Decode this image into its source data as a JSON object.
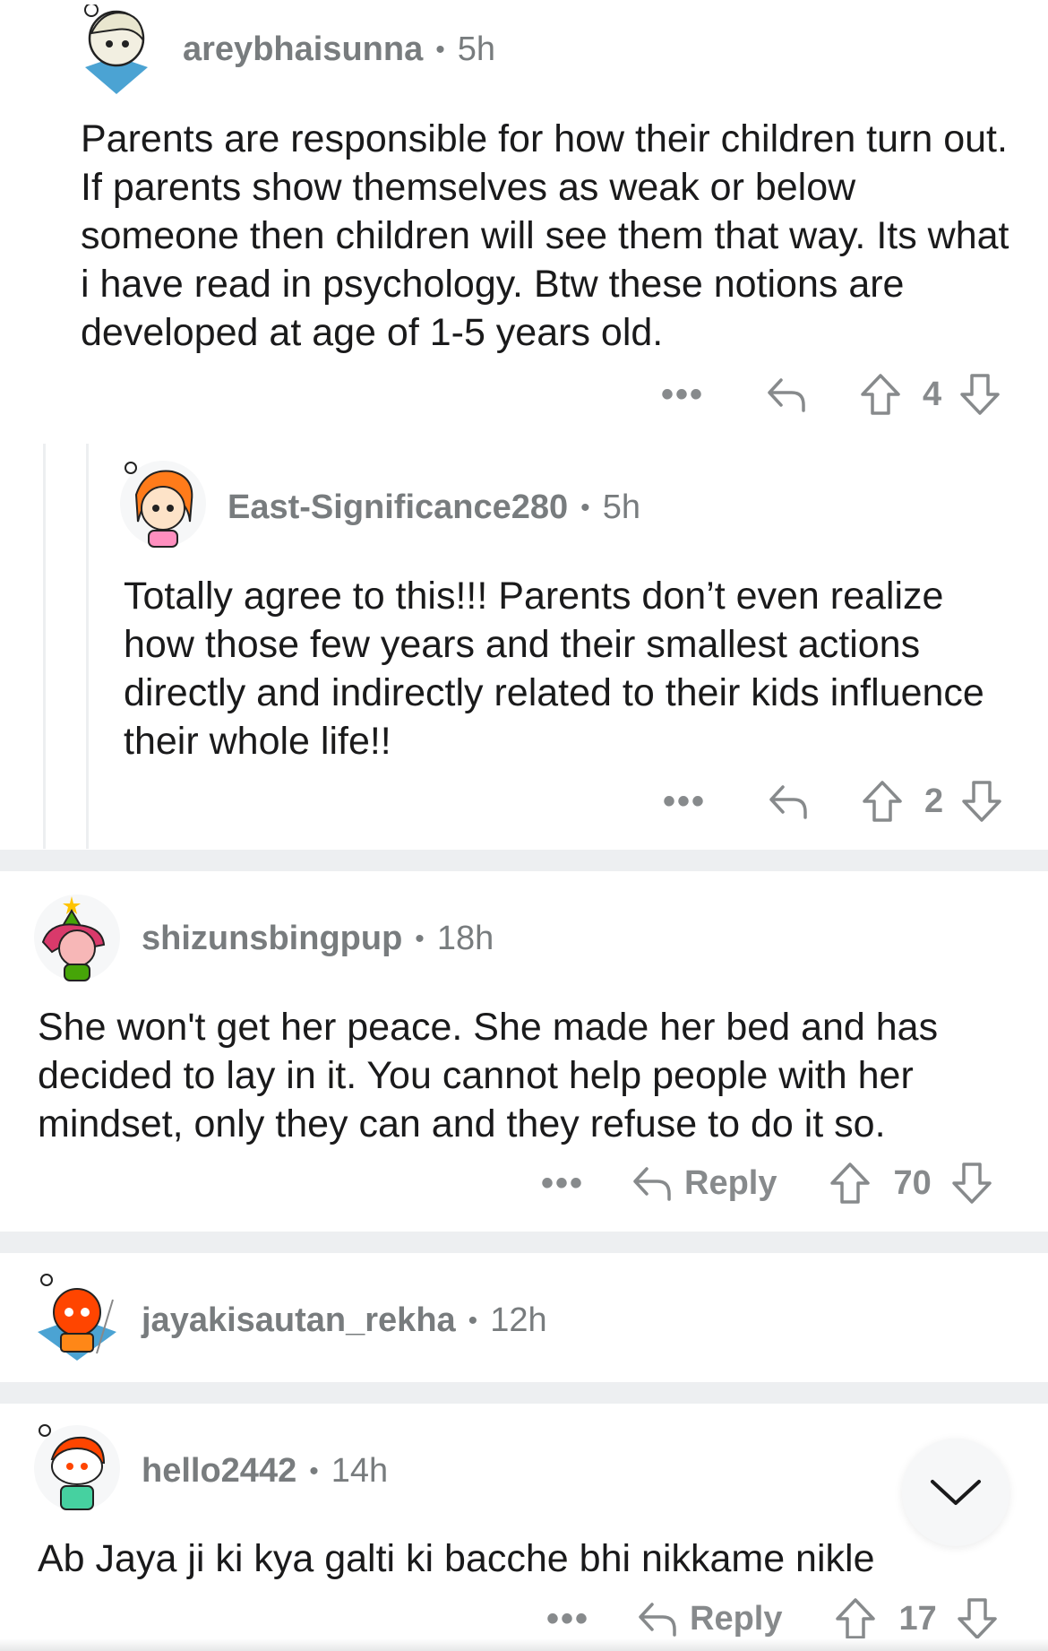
{
  "comments": [
    {
      "username": "areybhaisunna",
      "separator": "•",
      "age": "5h",
      "body": "Parents are responsible for how their children turn out. If parents show themselves as weak or below someone then children will see them that way. Its what i have read in psychology. Btw these notions are developed at age of 1-5 years old.",
      "more": "•••",
      "score": "4"
    },
    {
      "username": "East-Significance280",
      "separator": "•",
      "age": "5h",
      "body": "Totally agree to this!!! Parents don’t even realize how those few years and their smallest actions directly and indirectly related to their kids influence their whole life!!",
      "more": "•••",
      "score": "2"
    },
    {
      "username": "shizunsbingpup",
      "separator": "•",
      "age": "18h",
      "body": "She won't get her peace. She made her bed and has decided to lay in it.  You cannot help people with her mindset, only they can and they refuse to do it so.",
      "more": "•••",
      "reply_label": "Reply",
      "score": "70"
    },
    {
      "username": "jayakisautan_rekha",
      "separator": "•",
      "age": "12h"
    },
    {
      "username": "hello2442",
      "separator": "•",
      "age": "14h",
      "body": "Ab Jaya ji ki kya galti ki bacche bhi nikkame nikle",
      "more": "•••",
      "reply_label": "Reply",
      "score": "17"
    }
  ],
  "icons": {
    "reply": "reply-arrow-icon",
    "upvote": "upvote-arrow-icon",
    "downvote": "downvote-arrow-icon",
    "scroll": "chevron-down-icon"
  },
  "colors": {
    "text": "#1a1a1b",
    "meta": "#787c7e",
    "action": "#878a8c",
    "divider": "#edeff1"
  }
}
